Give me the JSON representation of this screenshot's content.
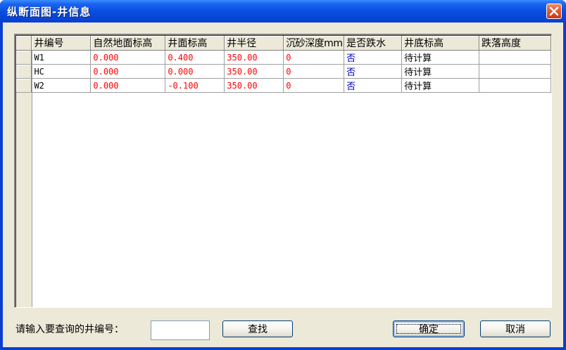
{
  "window": {
    "title": "纵断面图-井信息",
    "close_glyph": "✕"
  },
  "grid": {
    "columns": [
      "井编号",
      "自然地面标高",
      "井面标高",
      "井半径",
      "沉砂深度mm",
      "是否跌水",
      "井底标高",
      "跌落高度"
    ],
    "rows": [
      [
        "W1",
        "0.000",
        "0.400",
        "350.00",
        "0",
        "否",
        "待计算",
        ""
      ],
      [
        "HC",
        "0.000",
        "0.000",
        "350.00",
        "0",
        "否",
        "待计算",
        ""
      ],
      [
        "W2",
        "0.000",
        "-0.100",
        "350.00",
        "0",
        "否",
        "待计算",
        ""
      ]
    ]
  },
  "search": {
    "label": "请输入要查询的井编号：",
    "value": "",
    "find_label": "查找"
  },
  "buttons": {
    "ok_label": "确定",
    "cancel_label": "取消"
  },
  "colors": {
    "title_bar": "#0A4FE0",
    "value_red": "#FF0000",
    "value_blue": "#0000CC"
  }
}
